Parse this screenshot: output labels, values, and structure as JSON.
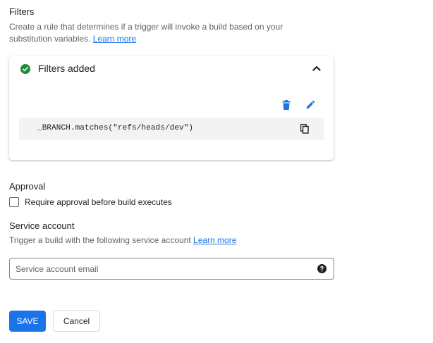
{
  "filters": {
    "title": "Filters",
    "description_line1": "Create a rule that determines if a trigger will invoke a build based on your",
    "description_line2": "substitution variables.",
    "learn_more": "Learn more",
    "card": {
      "header_label": "Filters added",
      "status_icon": "check-circle-icon",
      "status_color": "#1e8e3e",
      "collapse_icon": "chevron-up-icon",
      "delete_icon": "delete-icon",
      "edit_icon": "edit-icon",
      "filter_expression": "_BRANCH.matches(\"refs/heads/dev\")",
      "copy_icon": "copy-icon"
    }
  },
  "approval": {
    "title": "Approval",
    "checkbox_label": "Require approval before build executes",
    "checked": false
  },
  "service_account": {
    "title": "Service account",
    "description": "Trigger a build with the following service account",
    "learn_more": "Learn more",
    "input_placeholder": "Service account email",
    "input_value": "",
    "help_icon": "help-icon"
  },
  "actions": {
    "save_label": "SAVE",
    "cancel_label": "Cancel",
    "accent_color": "#1a73e8"
  }
}
